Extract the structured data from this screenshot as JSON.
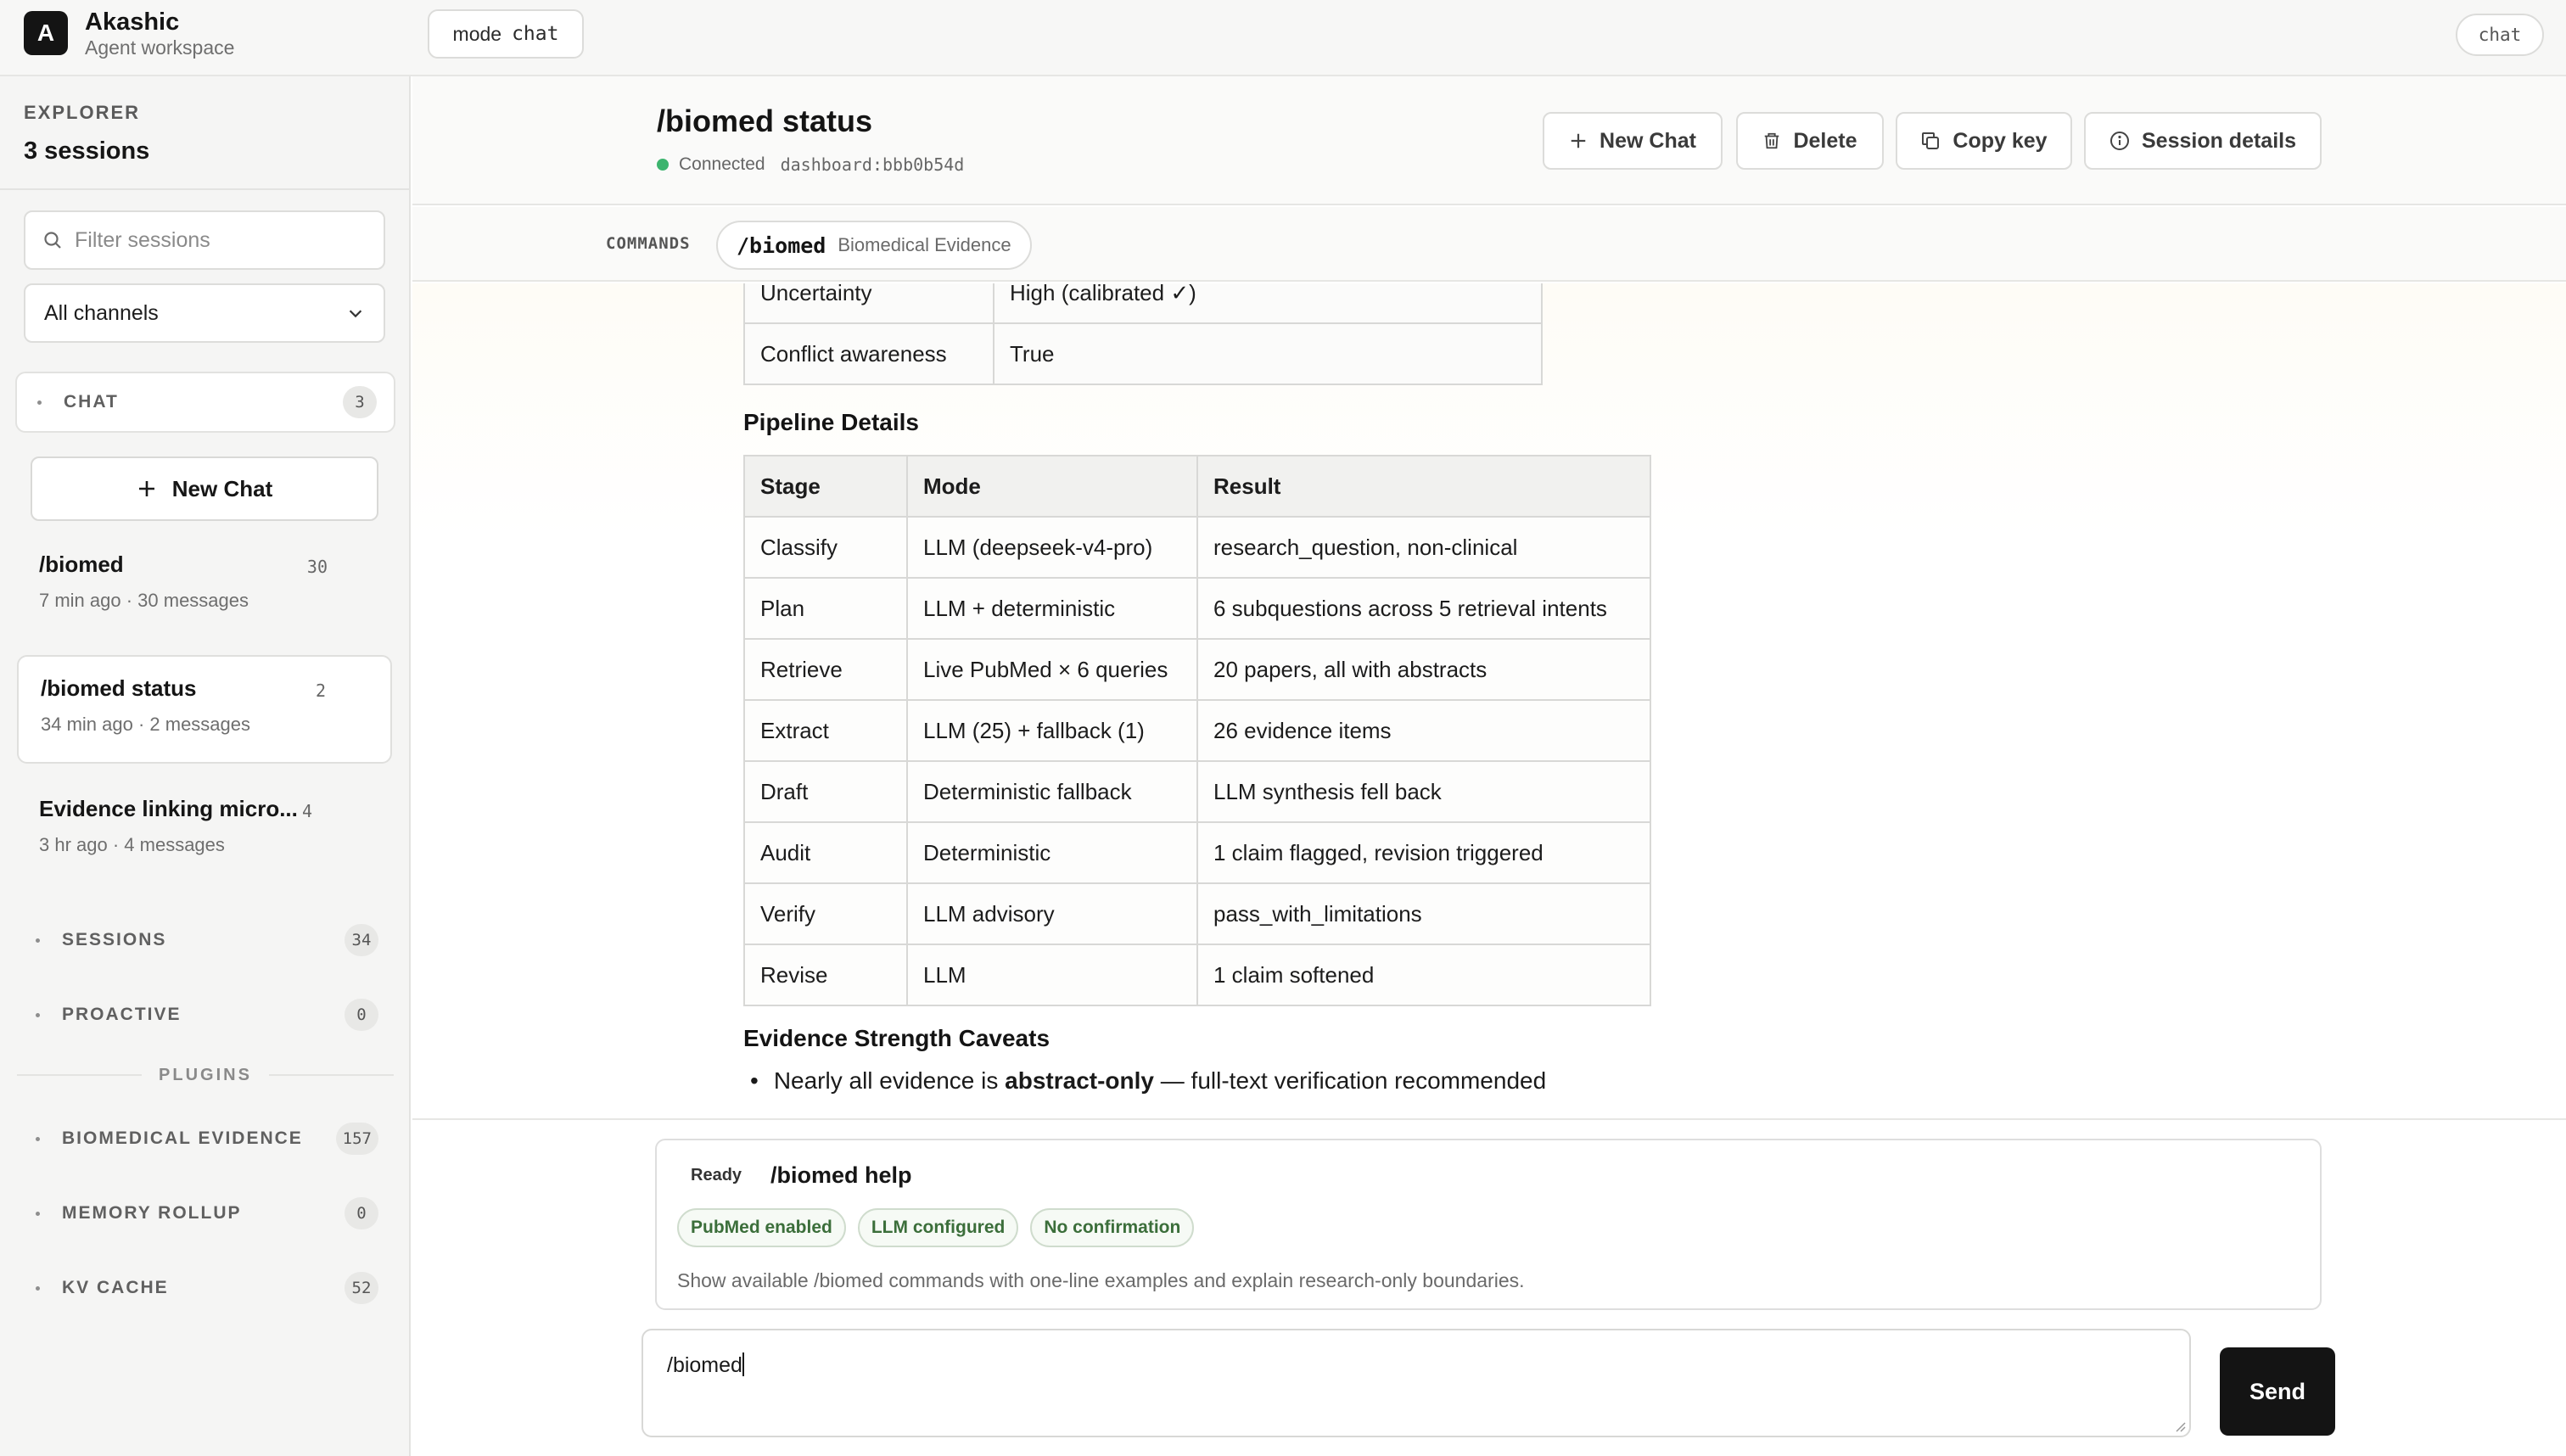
{
  "app": {
    "logo_letter": "A",
    "name": "Akashic",
    "subtitle": "Agent workspace"
  },
  "topbar": {
    "mode_label": "mode",
    "mode_value": "chat",
    "right_badge": "chat"
  },
  "sidebar": {
    "explorer_label": "EXPLORER",
    "sessions_count": "3 sessions",
    "filter_placeholder": "Filter sessions",
    "channel_select": "All channels",
    "chat_group": {
      "label": "CHAT",
      "count": "3"
    },
    "new_chat": "New Chat",
    "sessions": [
      {
        "title": "/biomed",
        "count": "30",
        "meta": "7 min ago · 30 messages"
      },
      {
        "title": "/biomed status",
        "count": "2",
        "meta": "34 min ago · 2 messages"
      },
      {
        "title": "Evidence linking micro...",
        "count": "4",
        "meta": "3 hr ago · 4 messages"
      }
    ],
    "groups": [
      {
        "label": "SESSIONS",
        "count": "34"
      },
      {
        "label": "PROACTIVE",
        "count": "0"
      }
    ],
    "plugins_label": "PLUGINS",
    "plugins": [
      {
        "label": "BIOMEDICAL EVIDENCE",
        "count": "157"
      },
      {
        "label": "MEMORY ROLLUP",
        "count": "0"
      },
      {
        "label": "KV CACHE",
        "count": "52"
      }
    ]
  },
  "header": {
    "title": "/biomed status",
    "connection": "Connected",
    "session_key": "dashboard:bbb0b54d",
    "buttons": {
      "new_chat": "New Chat",
      "delete": "Delete",
      "copy_key": "Copy key",
      "session_details": "Session details"
    }
  },
  "commands": {
    "label": "COMMANDS",
    "command": "/biomed",
    "description": "Biomedical Evidence"
  },
  "content": {
    "top_table": [
      {
        "key": "Uncertainty",
        "value": "High (calibrated ✓)"
      },
      {
        "key": "Conflict awareness",
        "value": "True"
      }
    ],
    "pipeline_heading": "Pipeline Details",
    "pipeline_columns": [
      "Stage",
      "Mode",
      "Result"
    ],
    "pipeline_rows": [
      [
        "Classify",
        "LLM (deepseek-v4-pro)",
        "research_question, non-clinical"
      ],
      [
        "Plan",
        "LLM + deterministic",
        "6 subquestions across 5 retrieval intents"
      ],
      [
        "Retrieve",
        "Live PubMed × 6 queries",
        "20 papers, all with abstracts"
      ],
      [
        "Extract",
        "LLM (25) + fallback (1)",
        "26 evidence items"
      ],
      [
        "Draft",
        "Deterministic fallback",
        "LLM synthesis fell back"
      ],
      [
        "Audit",
        "Deterministic",
        "1 claim flagged, revision triggered"
      ],
      [
        "Verify",
        "LLM advisory",
        "pass_with_limitations"
      ],
      [
        "Revise",
        "LLM",
        "1 claim softened"
      ]
    ],
    "caveats_heading": "Evidence Strength Caveats",
    "caveat_prefix": "Nearly all evidence is ",
    "caveat_bold": "abstract-only",
    "caveat_suffix": " — full-text verification recommended"
  },
  "suggestion": {
    "status": "Ready",
    "command": "/biomed help",
    "chips": [
      "PubMed enabled",
      "LLM configured",
      "No confirmation"
    ],
    "description": "Show available /biomed commands with one-line examples and explain research-only boundaries."
  },
  "composer": {
    "value": "/biomed",
    "send": "Send"
  }
}
